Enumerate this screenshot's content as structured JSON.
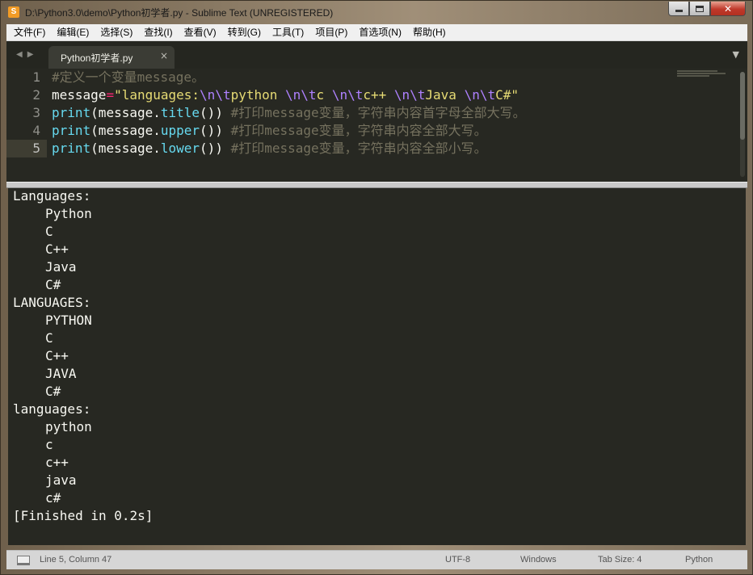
{
  "window": {
    "title": "D:\\Python3.0\\demo\\Python初学者.py - Sublime Text (UNREGISTERED)",
    "app_icon_letter": "S"
  },
  "menu": [
    "文件(F)",
    "编辑(E)",
    "选择(S)",
    "查找(I)",
    "查看(V)",
    "转到(G)",
    "工具(T)",
    "项目(P)",
    "首选项(N)",
    "帮助(H)"
  ],
  "tab": {
    "label": "Python初学者.py",
    "close": "×"
  },
  "editor": {
    "line_numbers": [
      "1",
      "2",
      "3",
      "4",
      "5"
    ],
    "lines": [
      [
        {
          "t": "#定义一个变量message。",
          "c": "cmt"
        }
      ],
      [
        {
          "t": "message",
          "c": ""
        },
        {
          "t": "=",
          "c": "op"
        },
        {
          "t": "\"languages:",
          "c": "str"
        },
        {
          "t": "\\n\\t",
          "c": "esc"
        },
        {
          "t": "python ",
          "c": "str"
        },
        {
          "t": "\\n\\t",
          "c": "esc"
        },
        {
          "t": "c ",
          "c": "str"
        },
        {
          "t": "\\n\\t",
          "c": "esc"
        },
        {
          "t": "c++ ",
          "c": "str"
        },
        {
          "t": "\\n\\t",
          "c": "esc"
        },
        {
          "t": "Java ",
          "c": "str"
        },
        {
          "t": "\\n\\t",
          "c": "esc"
        },
        {
          "t": "C#\"",
          "c": "str"
        }
      ],
      [
        {
          "t": "print",
          "c": "kw"
        },
        {
          "t": "(message.",
          "c": ""
        },
        {
          "t": "title",
          "c": "kw"
        },
        {
          "t": "()) ",
          "c": ""
        },
        {
          "t": "#打印message变量，字符串内容首字母全部大写。",
          "c": "cmt"
        }
      ],
      [
        {
          "t": "print",
          "c": "kw"
        },
        {
          "t": "(message.",
          "c": ""
        },
        {
          "t": "upper",
          "c": "kw"
        },
        {
          "t": "()) ",
          "c": ""
        },
        {
          "t": "#打印message变量，字符串内容全部大写。",
          "c": "cmt"
        }
      ],
      [
        {
          "t": "print",
          "c": "kw"
        },
        {
          "t": "(message.",
          "c": ""
        },
        {
          "t": "lower",
          "c": "kw"
        },
        {
          "t": "()) ",
          "c": ""
        },
        {
          "t": "#打印message变量，字符串内容全部小写。",
          "c": "cmt"
        }
      ]
    ]
  },
  "output": {
    "lines": [
      {
        "text": "Languages:",
        "indent": false
      },
      {
        "text": "Python",
        "indent": true
      },
      {
        "text": "C",
        "indent": true
      },
      {
        "text": "C++",
        "indent": true
      },
      {
        "text": "Java",
        "indent": true
      },
      {
        "text": "C#",
        "indent": true
      },
      {
        "text": "LANGUAGES:",
        "indent": false
      },
      {
        "text": "PYTHON",
        "indent": true
      },
      {
        "text": "C",
        "indent": true
      },
      {
        "text": "C++",
        "indent": true
      },
      {
        "text": "JAVA",
        "indent": true
      },
      {
        "text": "C#",
        "indent": true
      },
      {
        "text": "languages:",
        "indent": false
      },
      {
        "text": "python",
        "indent": true
      },
      {
        "text": "c",
        "indent": true
      },
      {
        "text": "c++",
        "indent": true
      },
      {
        "text": "java",
        "indent": true
      },
      {
        "text": "c#",
        "indent": true
      }
    ],
    "finished": "Finished in 0.2s"
  },
  "statusbar": {
    "position": "Line 5, Column 47",
    "encoding": "UTF-8",
    "line_endings": "Windows",
    "tab_size": "Tab Size: 4",
    "syntax": "Python"
  },
  "icons": {
    "app": "sublime-text-icon",
    "minimize": "minimize-icon",
    "maximize": "maximize-icon",
    "close": "close-icon",
    "nav_back": "chevron-left-icon",
    "nav_forward": "chevron-right-icon",
    "tab_dropdown": "chevron-down-icon",
    "panel_toggle": "panel-toggle-icon"
  }
}
